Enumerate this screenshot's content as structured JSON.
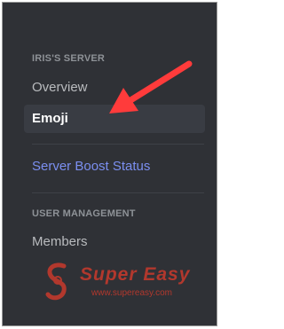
{
  "sidebar": {
    "server_section_header": "IRIS'S SERVER",
    "items": [
      {
        "label": "Overview"
      },
      {
        "label": "Emoji",
        "selected": true
      },
      {
        "label": "Server Boost Status"
      }
    ],
    "user_management_header": "USER MANAGEMENT",
    "members_label": "Members"
  },
  "annotation": {
    "arrow_icon": "red-arrow-icon",
    "color": "#ff3b3b"
  },
  "watermark": {
    "brand": "Super Easy",
    "url": "www.supereasy.com",
    "logo_icon": "supereasy-logo-icon",
    "color": "#b2382d"
  },
  "colors": {
    "background": "#2f3136",
    "selected_bg": "#393c43",
    "boost_link": "#7b8ff0",
    "text": "#b9bbbe",
    "header": "#8e9297"
  }
}
